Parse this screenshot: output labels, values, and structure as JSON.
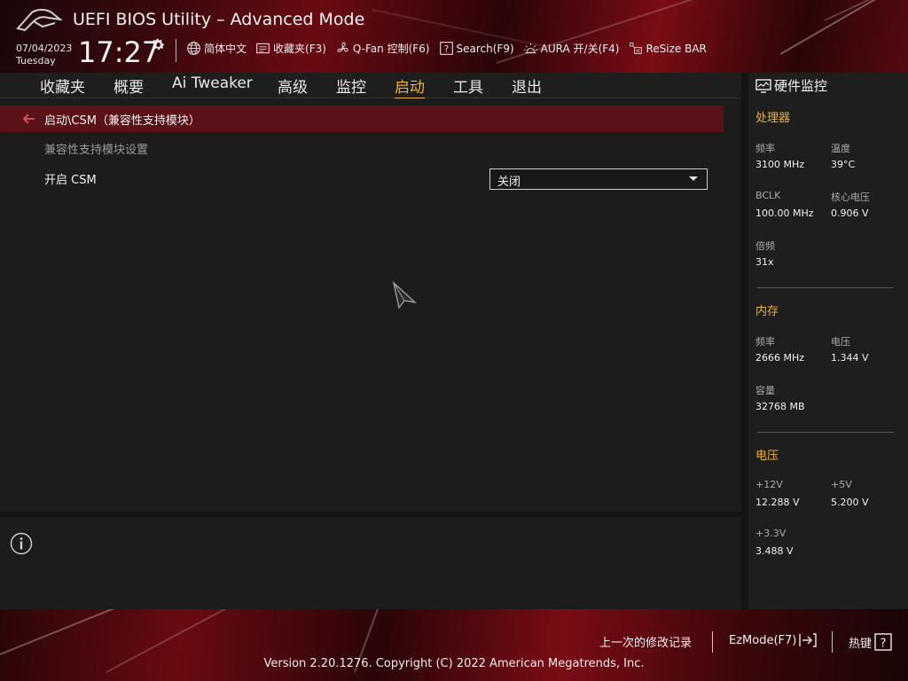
{
  "header": {
    "title": "UEFI BIOS Utility – Advanced Mode",
    "date": "07/04/2023",
    "weekday": "Tuesday",
    "time": "17:27",
    "toolbar": {
      "language": "简体中文",
      "favorites": "收藏夹(F3)",
      "qfan": "Q-Fan 控制(F6)",
      "search": "Search(F9)",
      "aura": "AURA 开/关(F4)",
      "resize_bar": "ReSize BAR"
    }
  },
  "nav": {
    "items": [
      "收藏夹",
      "概要",
      "Ai Tweaker",
      "高级",
      "监控",
      "启动",
      "工具",
      "退出"
    ],
    "active": "启动"
  },
  "main": {
    "breadcrumb": "启动\\CSM（兼容性支持模块）",
    "section_label": "兼容性支持模块设置",
    "csm_label": "开启 CSM",
    "csm_value": "关闭"
  },
  "monitor": {
    "title": "硬件监控",
    "cpu": {
      "heading": "处理器",
      "freq_label": "频率",
      "freq": "3100 MHz",
      "temp_label": "温度",
      "temp": "39°C",
      "bclk_label": "BCLK",
      "bclk": "100.00 MHz",
      "vcore_label": "核心电压",
      "vcore": "0.906 V",
      "ratio_label": "倍频",
      "ratio": "31x"
    },
    "memory": {
      "heading": "内存",
      "freq_label": "频率",
      "freq": "2666 MHz",
      "volt_label": "电压",
      "volt": "1.344 V",
      "cap_label": "容量",
      "cap": "32768 MB"
    },
    "voltage": {
      "heading": "电压",
      "v12_label": "+12V",
      "v12": "12.288 V",
      "v5_label": "+5V",
      "v5": "5.200 V",
      "v33_label": "+3.3V",
      "v33": "3.488 V"
    }
  },
  "footer": {
    "last_modified": "上一次的修改记录",
    "ezmode": "EzMode(F7)",
    "hotkeys": "热键",
    "copyright": "Version 2.20.1276. Copyright (C) 2022 American Megatrends, Inc."
  },
  "colors": {
    "accent": "#e9b233",
    "breadcrumb_bg": "#5a1218",
    "panel_bg": "#1c1c1c",
    "brand_red": "#6a0a12"
  }
}
